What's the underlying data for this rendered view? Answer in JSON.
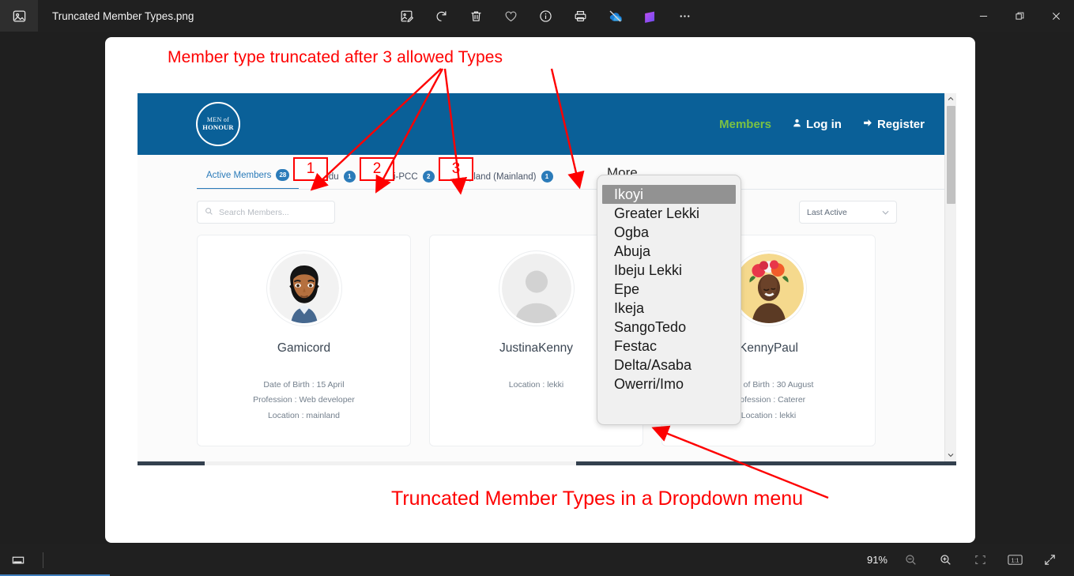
{
  "window": {
    "app_icon": "photos-app-icon",
    "file_title": "Truncated Member Types.png",
    "toolbar": [
      {
        "name": "edit-image-icon",
        "label": "Edit image"
      },
      {
        "name": "rotate-icon",
        "label": "Rotate"
      },
      {
        "name": "delete-icon",
        "label": "Delete"
      },
      {
        "name": "favorite-heart-icon",
        "label": "Add to favorites"
      },
      {
        "name": "info-icon",
        "label": "File info"
      },
      {
        "name": "print-icon",
        "label": "Print"
      },
      {
        "name": "onedrive-off-icon",
        "label": "OneDrive sync off"
      },
      {
        "name": "clipchamp-icon",
        "label": "Edit with Clipchamp"
      },
      {
        "name": "more-options-icon",
        "label": "See more"
      }
    ],
    "controls": {
      "minimize": "minimize-button",
      "restore": "restore-button",
      "close": "close-button"
    }
  },
  "statusbar": {
    "filmstrip_icon": "filmstrip-toggle-icon",
    "zoom_level": "91%",
    "buttons": [
      {
        "name": "zoom-out-button",
        "label": "Zoom out"
      },
      {
        "name": "zoom-in-button",
        "label": "Zoom in"
      },
      {
        "name": "fit-to-window-button",
        "label": "Fit to window"
      },
      {
        "name": "actual-size-button",
        "label": "1:1"
      },
      {
        "name": "fullscreen-button",
        "label": "Full screen"
      }
    ],
    "actual_size_label": "1:1"
  },
  "annotations": {
    "top": "Member type truncated after 3 allowed Types",
    "bottom": "Truncated Member Types in a Dropdown menu",
    "boxes": [
      "1",
      "2",
      "3"
    ],
    "color": "#fe0000"
  },
  "site": {
    "brand": {
      "line1": "MEN of",
      "line2": "HONOUR"
    },
    "header_color": "#0a6098",
    "nav": [
      {
        "name": "nav-members",
        "label": "Members",
        "color": "#7bc143",
        "icon": ""
      },
      {
        "name": "nav-login",
        "label": "Log in",
        "icon": "user-icon"
      },
      {
        "name": "nav-register",
        "label": "Register",
        "icon": "sign-in-icon"
      }
    ],
    "tabs": [
      {
        "label": "Active Members",
        "count": "28",
        "active": true
      },
      {
        "label": "Ikorodu",
        "count": "1",
        "active": false
      },
      {
        "label": "Lekki-PCC",
        "count": "2",
        "active": false
      },
      {
        "label": "Maryland (Mainland)",
        "count": "1",
        "active": false
      }
    ],
    "more_tab": {
      "label": "More",
      "chevron": "chevron-down-icon"
    },
    "search": {
      "placeholder": "Search Members...",
      "value": "",
      "icon": "search-icon"
    },
    "sort": {
      "selected": "Last Active",
      "chevron": "chevron-down-icon"
    },
    "dropdown": {
      "selected": "Ikoyi",
      "items": [
        "Ikoyi",
        "Greater Lekki",
        "Ogba",
        "Abuja",
        "Ibeju Lekki",
        "Epe",
        "Ikeja",
        "SangoTedo",
        "Festac",
        "Delta/Asaba",
        "Owerri/Imo"
      ]
    },
    "members": [
      {
        "name": "Gamicord",
        "avatar": "avatar-male-illustration",
        "dob": "Date of Birth : 15 April",
        "profession": "Profession : Web developer",
        "location": "Location : mainland"
      },
      {
        "name": "JustinaKenny",
        "avatar": "avatar-placeholder",
        "dob": "",
        "profession": "",
        "location": "Location : lekki"
      },
      {
        "name": "KennyPaul",
        "avatar": "avatar-female-photo",
        "dob": "Date of Birth : 30 August",
        "profession": "Profession : Caterer",
        "location": "Location : lekki"
      }
    ]
  }
}
